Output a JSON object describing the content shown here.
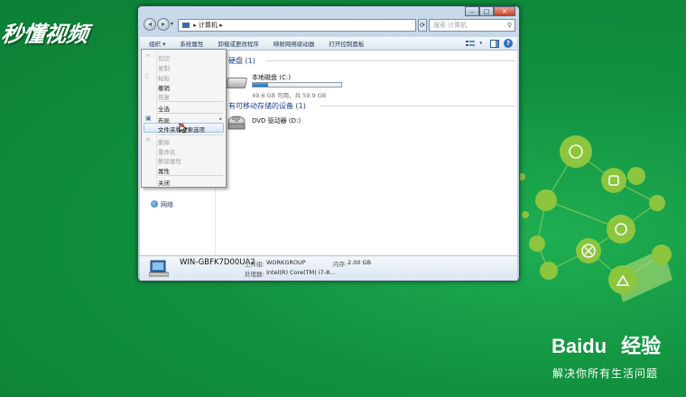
{
  "watermark_top": "秒懂视频",
  "baidu": {
    "logo": "Baidu",
    "logo_cn": "经验",
    "tagline": "解决你所有生活问题"
  },
  "window": {
    "address": "计算机",
    "search_placeholder": "搜索 计算机",
    "controls": {
      "minimize": "–",
      "maximize": "□",
      "close": "✕"
    },
    "toolbar": {
      "organize": "组织 ▾",
      "system_properties": "系统属性",
      "uninstall": "卸载或更改程序",
      "map_drive": "映射网络驱动器",
      "control_panel": "打开控制面板",
      "help": "?"
    },
    "nav": {
      "network": "网络"
    },
    "groups": {
      "hdd_header": "硬盘 (1)",
      "removable_header": "有可移动存储的设备 (1)"
    },
    "drive_c": {
      "name": "本地磁盘 (C:)",
      "free_text": "49.6 GB 可用，共 59.9 GB",
      "used_fraction": 0.17
    },
    "dvd": {
      "name": "DVD 驱动器 (D:)",
      "label": "DVD"
    },
    "details": {
      "computer_name": "WIN-GBFK7D00UA2",
      "workgroup_label": "工作组:",
      "workgroup_value": "WORKGROUP",
      "memory_label": "内存:",
      "memory_value": "2.00 GB",
      "processor_label": "处理器:",
      "processor_value": "Intel(R) Core(TM) i7-8..."
    }
  },
  "menu": {
    "cut": "剪切",
    "copy": "复制",
    "paste": "粘贴",
    "undo": "撤销",
    "redo": "恢复",
    "select_all": "全选",
    "layout": "布局",
    "folder_options": "文件夹和搜索选项",
    "delete": "删除",
    "rename": "重命名",
    "remove_properties": "删除属性",
    "properties": "属性",
    "close": "关闭"
  },
  "colors": {
    "background": "#11913f",
    "highlight": "#dbe9f8",
    "link_blue": "#1d3f8a"
  }
}
